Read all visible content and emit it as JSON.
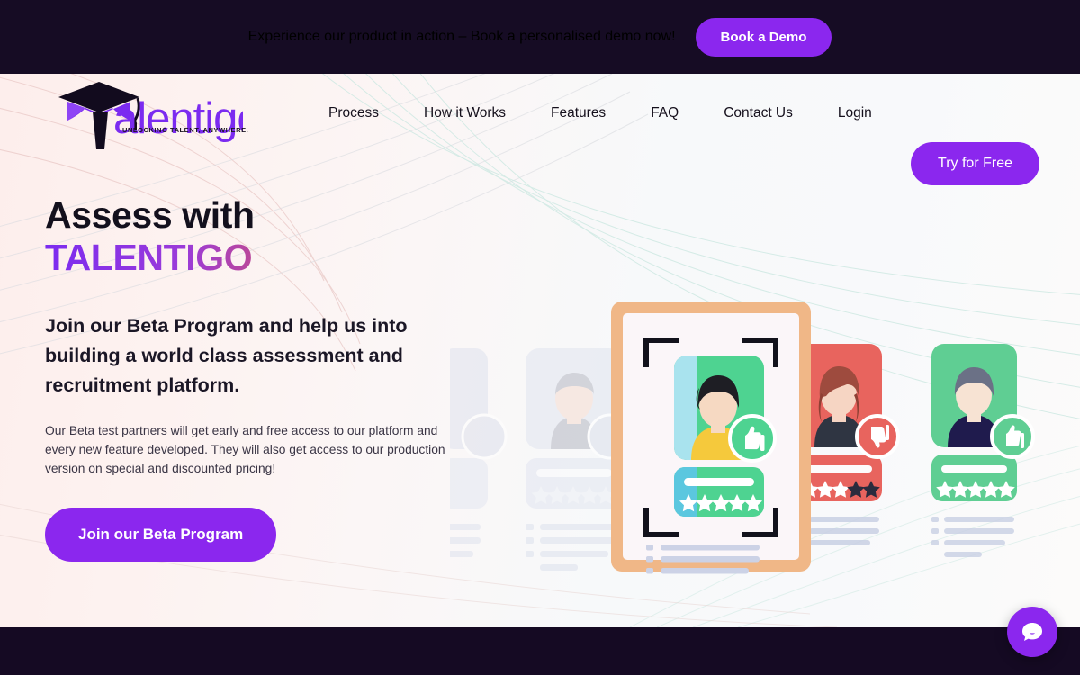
{
  "announcement": {
    "text": "Experience our product in action – Book a personalised demo now!",
    "button_label": "Book a Demo",
    "bg_color": "#160C24",
    "button_color": "#8B27EE"
  },
  "header": {
    "logo": {
      "name": "Talentigo",
      "wordmark": "alentigo",
      "tagline": "UNLOCKING TALENT, ANYWHERE.",
      "cap_icon": "graduation-cap-icon",
      "purple": "#7B2BF0",
      "dark": "#120B1E"
    },
    "nav_items": [
      {
        "label": "Process"
      },
      {
        "label": "How it Works"
      },
      {
        "label": "Features"
      },
      {
        "label": "FAQ"
      },
      {
        "label": "Contact Us"
      },
      {
        "label": "Login"
      }
    ],
    "cta": {
      "label": "Try for Free",
      "color": "#8B27EE"
    }
  },
  "hero": {
    "heading_line1": "Assess with",
    "heading_line2": "TALENTIGO",
    "heading_gradient_from": "#7B2BF0",
    "heading_gradient_to": "#F08030",
    "subheading": "Join our Beta Program and help us into building a world class assessment and recruitment platform.",
    "body": "Our Beta test partners will get early and free access to our platform and every new feature developed. They will also get access to our production version on special and discounted pricing!",
    "cta": {
      "label": "Join our Beta Program",
      "color": "#8B27EE"
    }
  },
  "illustration": {
    "name": "candidate-assessment-cards",
    "frame_color": "#F0B787",
    "cards": [
      {
        "id": "faded-left-1",
        "state": "faded",
        "color": "#dfe3ee",
        "rating": 5,
        "badge": "none"
      },
      {
        "id": "faded-left-2",
        "state": "faded",
        "color": "#dfe3ee",
        "rating": 5,
        "badge": "none"
      },
      {
        "id": "center-green",
        "state": "selected",
        "color": "#4ED391",
        "rating": 5,
        "badge": "thumbs-up",
        "badge_color": "#4ED391"
      },
      {
        "id": "right-red",
        "state": "rejected",
        "color": "#E8645E",
        "rating": 3,
        "badge": "thumbs-down",
        "badge_color": "#E8645E"
      },
      {
        "id": "right-green",
        "state": "approved",
        "color": "#5FCE93",
        "rating": 5,
        "badge": "thumbs-up",
        "badge_color": "#5FCE93"
      }
    ]
  },
  "chat_widget": {
    "name": "chat-bubble-icon",
    "color": "#8B27EE"
  }
}
